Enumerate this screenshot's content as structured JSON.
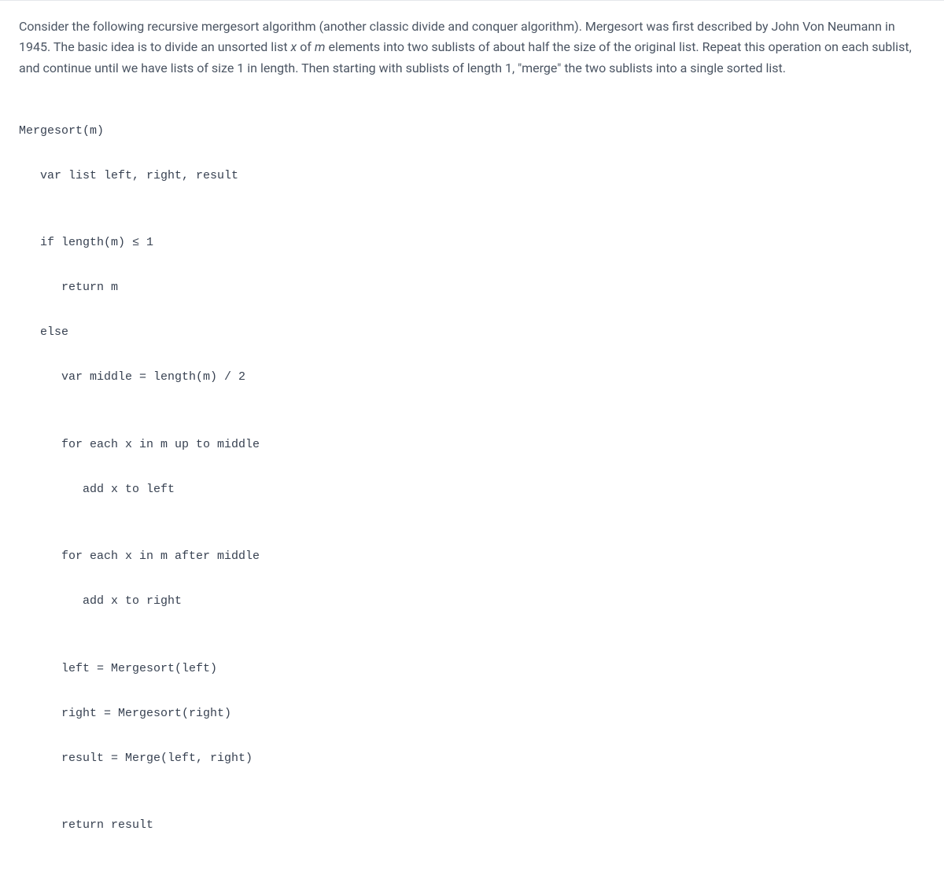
{
  "description": {
    "text1": "Consider the following recursive mergesort algorithm (another classic divide and conquer algorithm). Mergesort was first described by John Von Neumann in 1945. The basic idea is to divide an unsorted list ",
    "var_x": "x",
    "text2": " of ",
    "var_m": "m",
    "text3": " elements into two sublists of about half the size of the original list. Repeat this operation on each sublist, and continue until we have lists of size 1 in length. Then starting with sublists of length 1, \"merge\" the two sublists into a single sorted list."
  },
  "code": {
    "l1": "Mergesort(m)",
    "l2": "   var list left, right, result",
    "l3": "",
    "l4": "   if length(m) ≤ 1",
    "l5": "      return m",
    "l6": "   else",
    "l7": "      var middle = length(m) / 2",
    "l8": "",
    "l9": "      for each x in m up to middle",
    "l10": "         add x to left",
    "l11": "",
    "l12": "      for each x in m after middle",
    "l13": "         add x to right",
    "l14": "",
    "l15": "      left = Mergesort(left)",
    "l16": "      right = Mergesort(right)",
    "l17": "      result = Merge(left, right)",
    "l18": "",
    "l19": "      return result"
  }
}
